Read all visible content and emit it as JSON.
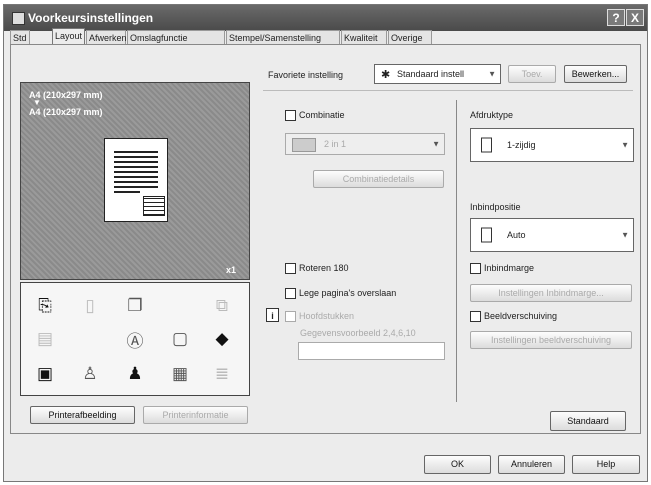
{
  "window": {
    "title": "Voorkeursinstellingen",
    "help_button": "?",
    "close_button": "X"
  },
  "tabs": [
    "Std",
    "Layout",
    "Afwerken",
    "Omslagfunctie",
    "Stempel/Samenstelling",
    "Kwaliteit",
    "Overige"
  ],
  "active_tab": "Layout",
  "preview": {
    "label_top": "A4 (210x297 mm)",
    "arrow": "▼",
    "label_bottom": "A4 (210x297 mm)",
    "corner": "x1"
  },
  "favorite": {
    "label": "Favoriete instelling",
    "value": "Standaard instell",
    "add_button": "Toev.",
    "edit_button": "Bewerken..."
  },
  "combinatie": {
    "label": "Combinatie",
    "checked": false,
    "value": "2 in 1",
    "details_button": "Combinatiedetails"
  },
  "rotate": {
    "label": "Roteren 180",
    "checked": false
  },
  "skip_blank": {
    "label": "Lege pagina's overslaan",
    "checked": false
  },
  "headings": {
    "label": "Hoofdstukken",
    "sample_label": "Gegevensvoorbeeld 2,4,6,10",
    "value": ""
  },
  "print_type": {
    "label": "Afdruktype",
    "value": "1-zijdig"
  },
  "binding": {
    "label": "Inbindpositie",
    "value": "Auto"
  },
  "binding_margin": {
    "label": "Inbindmarge",
    "checked": false,
    "settings_button": "Instellingen Inbindmarge..."
  },
  "image_shift": {
    "label": "Beeldverschuiving",
    "checked": false,
    "settings_button": "Instellingen beeldverschuiving"
  },
  "bottom_left": {
    "printer_view": "Printerafbeelding",
    "printer_info": "Printerinformatie"
  },
  "standard_button": "Standaard",
  "footer": {
    "ok": "OK",
    "cancel": "Annuleren",
    "help": "Help"
  }
}
